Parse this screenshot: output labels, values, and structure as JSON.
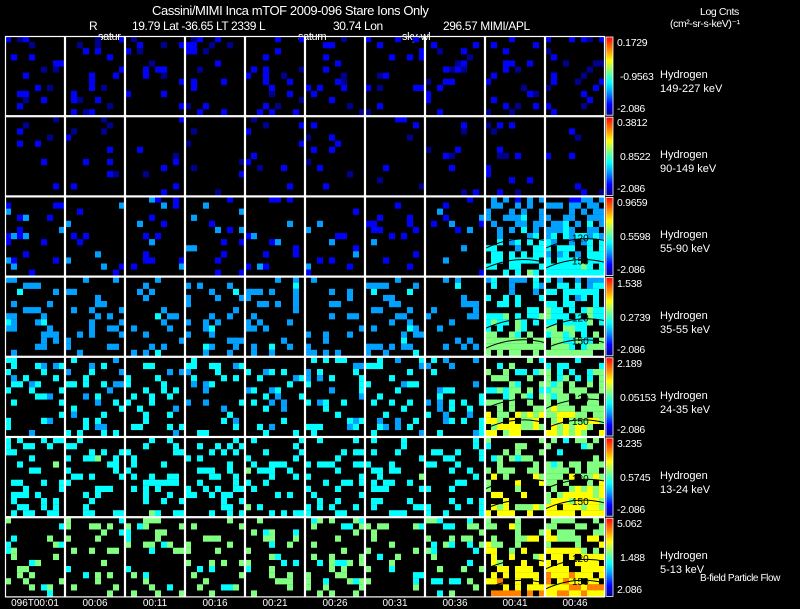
{
  "header": {
    "title": "Cassini/MIMI Inca mTOF  2009-096   Stare   Ions Only",
    "r_label": "R",
    "coords": "19.79 Lat -36.65 LT 2339 L",
    "l_value": "30.74 Lon",
    "lon_value": "296.57  MIMI/APL",
    "overlay_1": "satur",
    "overlay_2": "saturn",
    "overlay_3": "sky-wl",
    "units_line1": "Log Cnts",
    "units_line2": "(cm²-sr-s-keV)⁻¹"
  },
  "footer_note": "B-field Particle Flow",
  "colors": {
    "background": "#000000",
    "frame": "#ffffff",
    "contour": "#000000"
  },
  "chart_data": {
    "type": "heatmap",
    "colormap": [
      "#00008f",
      "#0000ff",
      "#00a0ff",
      "#00ffff",
      "#80ff80",
      "#ffff00",
      "#ff8000",
      "#ff0000"
    ],
    "time_labels": [
      "096T00:01",
      "00:06",
      "00:11",
      "00:16",
      "00:21",
      "00:26",
      "00:31",
      "00:36",
      "00:41",
      "00:46"
    ],
    "contour_labels": [
      "120",
      "150"
    ],
    "rows": [
      {
        "species": "Hydrogen",
        "energy": "149-227 keV",
        "max": "0.1729",
        "mid": "-0.9563",
        "min": "-2.086"
      },
      {
        "species": "Hydrogen",
        "energy": "90-149 keV",
        "max": "0.3812",
        "mid": "0.8522",
        "min": "-2.086"
      },
      {
        "species": "Hydrogen",
        "energy": "55-90 keV",
        "max": "0.9659",
        "mid": "0.5598",
        "min": "-2.086"
      },
      {
        "species": "Hydrogen",
        "energy": "35-55 keV",
        "max": "1.538",
        "mid": "0.2739",
        "min": "-2.086"
      },
      {
        "species": "Hydrogen",
        "energy": "24-35 keV",
        "max": "2.189",
        "mid": "0.05153",
        "min": "-2.086"
      },
      {
        "species": "Hydrogen",
        "energy": "13-24 keV",
        "max": "3.235",
        "mid": "0.5745",
        "min": "-2.086"
      },
      {
        "species": "Hydrogen",
        "energy": "5-13 keV",
        "max": "5.062",
        "mid": "1.488",
        "min": "2.086"
      }
    ]
  }
}
